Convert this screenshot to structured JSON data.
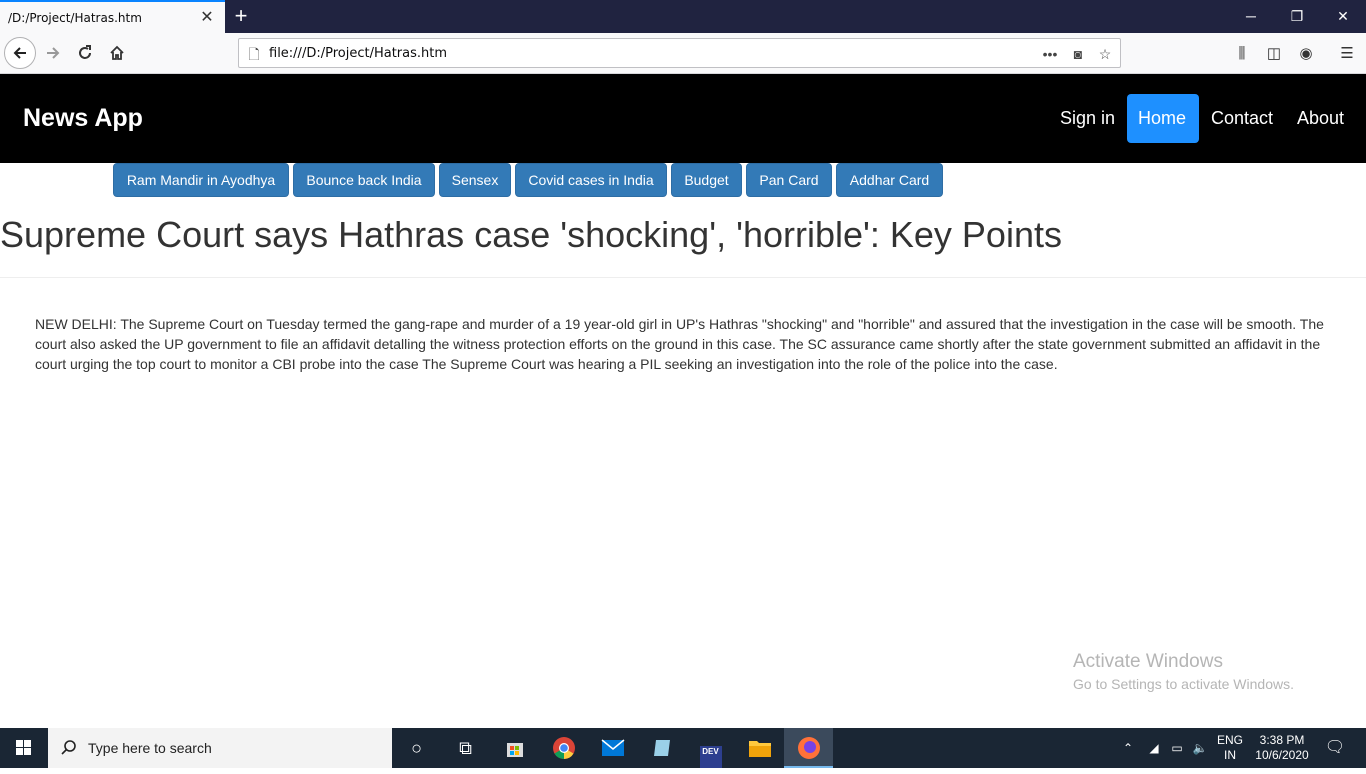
{
  "browser": {
    "tab_title": "/D:/Project/Hatras.htm",
    "url": "file:///D:/Project/Hatras.htm",
    "accent": "#0a84ff"
  },
  "site": {
    "brand": "News App",
    "nav": [
      {
        "label": "Sign in",
        "active": false
      },
      {
        "label": "Home",
        "active": true
      },
      {
        "label": "Contact",
        "active": false
      },
      {
        "label": "About",
        "active": false
      }
    ],
    "active_color": "#1e90ff",
    "topics": [
      "Ram Mandir in Ayodhya",
      "Bounce back India",
      "Sensex",
      "Covid cases in India",
      "Budget",
      "Pan Card",
      "Addhar Card"
    ],
    "topic_color": "#337ab7"
  },
  "article": {
    "headline": "Supreme Court says Hathras case 'shocking', 'horrible': Key Points",
    "body": "NEW DELHI: The Supreme Court on Tuesday termed the gang-rape and murder of a 19 year-old girl in UP's Hathras \"shocking\" and \"horrible\" and assured that the investigation in the case will be smooth. The court also asked the UP government to file an affidavit detalling the witness protection efforts on the ground in this case. The SC assurance came shortly after the state government submitted an affidavit in the court urging the top court to monitor a CBI probe into the case The Supreme Court was hearing a PIL seeking an investigation into the role of the police into the case."
  },
  "watermark": {
    "line1": "Activate Windows",
    "line2": "Go to Settings to activate Windows."
  },
  "taskbar": {
    "search_placeholder": "Type here to search",
    "lang": "ENG",
    "region": "IN",
    "time": "3:38 PM",
    "date": "10/6/2020",
    "dev_label": "DEV"
  }
}
